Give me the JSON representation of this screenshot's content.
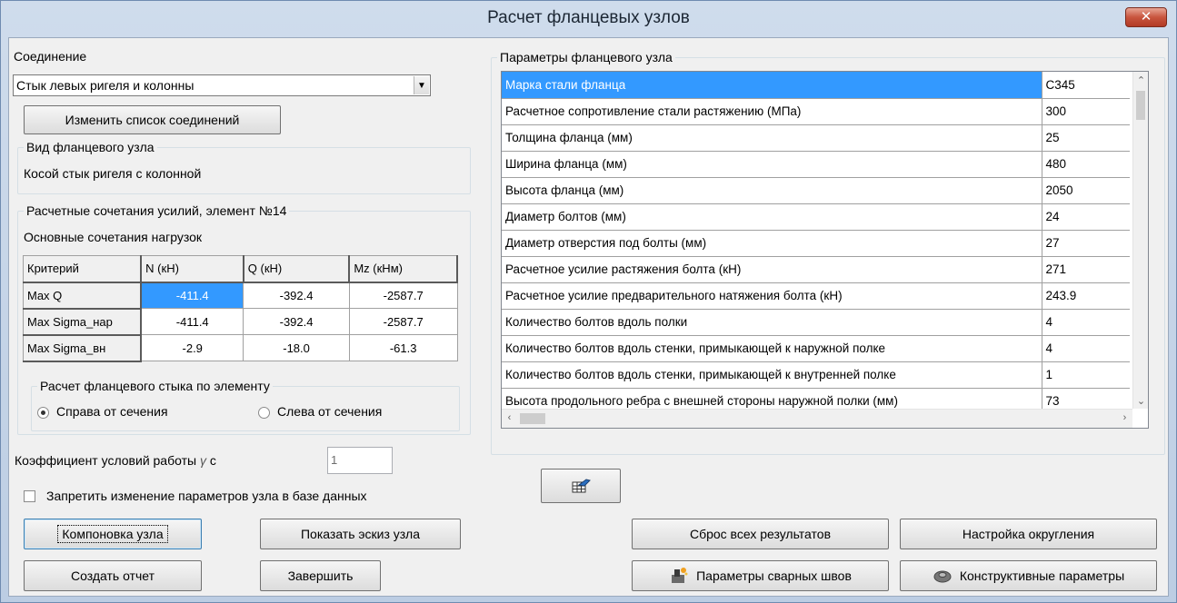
{
  "window": {
    "title": "Расчет фланцевых узлов",
    "close_glyph": "✕"
  },
  "connection": {
    "label": "Соединение",
    "selected": "Стык левых ригеля и колонны",
    "edit_button": "Изменить список соединений"
  },
  "joint_type": {
    "title": "Вид фланцевого узла",
    "value": "Косой стык ригеля с колонной"
  },
  "combinations": {
    "title": "Расчетные сочетания усилий, элемент №14",
    "subtitle": "Основные сочетания нагрузок",
    "headers": [
      "Критерий",
      "N (кН)",
      "Q (кН)",
      "Mz (кНм)"
    ],
    "rows": [
      {
        "criterion": "Max Q",
        "n": "-411.4",
        "q": "-392.4",
        "mz": "-2587.7"
      },
      {
        "criterion": "Max Sigma_нар",
        "n": "-411.4",
        "q": "-392.4",
        "mz": "-2587.7"
      },
      {
        "criterion": "Max Sigma_вн",
        "n": "-2.9",
        "q": "-18.0",
        "mz": "-61.3"
      }
    ]
  },
  "flange_calc": {
    "title": "Расчет фланцевого стыка по элементу",
    "option_right": "Справа от сечения",
    "option_left": "Слева от сечения",
    "selected": "right"
  },
  "work_coef": {
    "label": "Коэффициент условий работы ",
    "gamma": "γ",
    "suffix": " c",
    "value": "1"
  },
  "lock_params": {
    "label": "Запретить изменение параметров узла в базе данных",
    "checked": false
  },
  "params": {
    "title": "Параметры фланцевого узла",
    "rows": [
      {
        "name": "Марка стали фланца",
        "value": "С345"
      },
      {
        "name": "Расчетное сопротивление стали растяжению (МПа)",
        "value": "300"
      },
      {
        "name": "Толщина фланца (мм)",
        "value": "25"
      },
      {
        "name": "Ширина фланца (мм)",
        "value": "480"
      },
      {
        "name": "Высота фланца (мм)",
        "value": "2050"
      },
      {
        "name": "Диаметр болтов (мм)",
        "value": "24"
      },
      {
        "name": "Диаметр отверстия под болты (мм)",
        "value": "27"
      },
      {
        "name": "Расчетное усилие растяжения болта (кН)",
        "value": "271"
      },
      {
        "name": "Расчетное усилие предварительного натяжения болта (кН)",
        "value": "243.9"
      },
      {
        "name": "Количество болтов вдоль полки",
        "value": "4"
      },
      {
        "name": "Количество болтов вдоль стенки, примыкающей к наружной полке",
        "value": "4"
      },
      {
        "name": "Количество болтов вдоль стенки, примыкающей к внутренней полке",
        "value": "1"
      },
      {
        "name": "Высота продольного ребра с внешней стороны наружной полки (мм)",
        "value": "73"
      }
    ]
  },
  "buttons": {
    "layout": "Компоновка узла",
    "show_sketch": "Показать эскиз узла",
    "create_report": "Создать отчет",
    "finish": "Завершить",
    "reset_results": "Сброс всех результатов",
    "rounding": "Настройка округления",
    "weld_params": "Параметры сварных швов",
    "design_params": "Конструктивные параметры"
  },
  "icons": {
    "export": "export-table-icon",
    "weld": "weld-icon",
    "design": "design-params-icon"
  }
}
